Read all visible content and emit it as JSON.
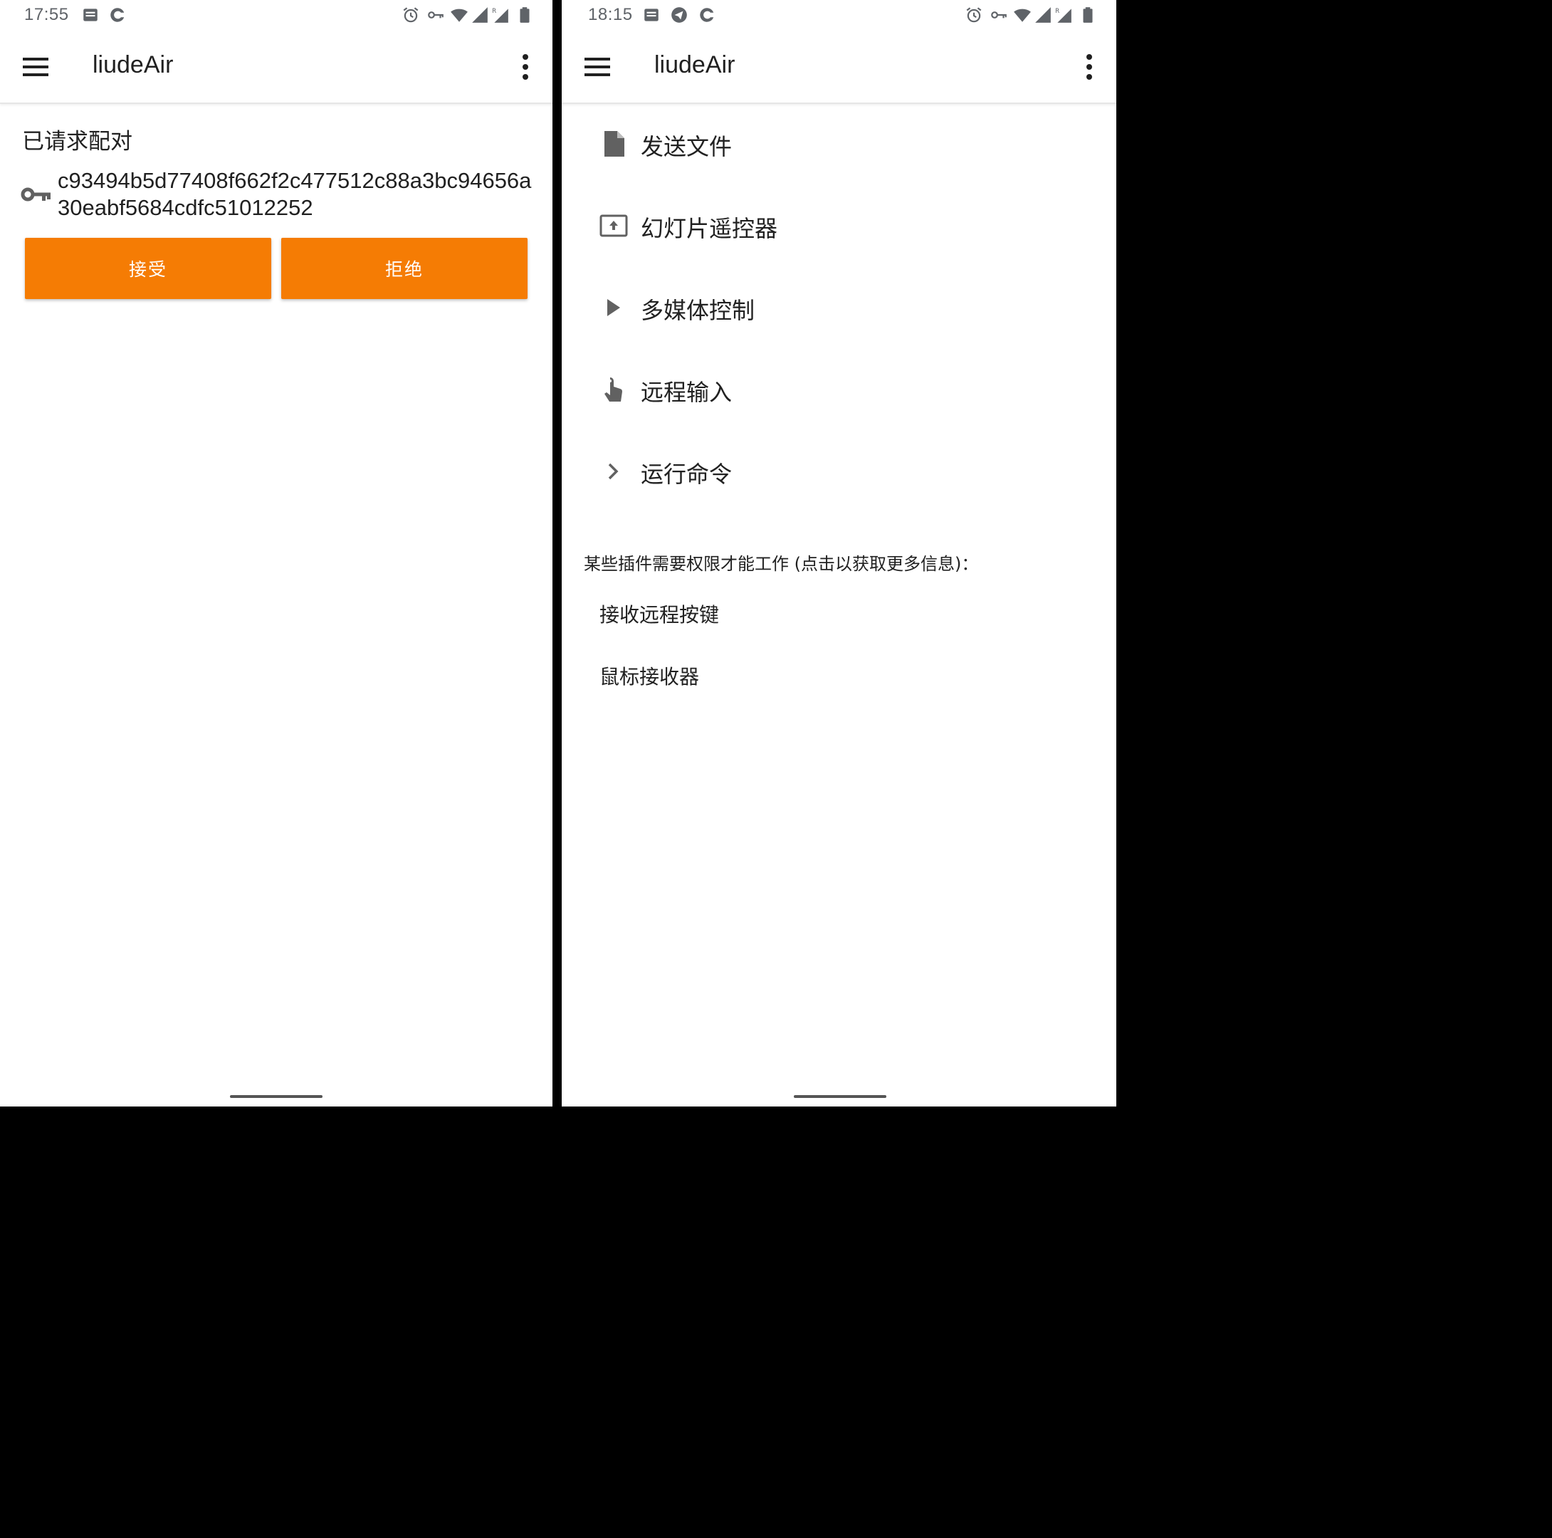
{
  "left": {
    "status": {
      "time": "17:55",
      "icons": [
        "notification-icon",
        "sync-icon",
        "alarm-icon",
        "vpn-key-icon",
        "wifi-icon",
        "signal-icon",
        "signal-roaming-icon",
        "battery-icon"
      ]
    },
    "toolbar": {
      "title": "liudeAir",
      "menu_icon": "hamburger-menu-icon",
      "overflow_icon": "more-vert-icon"
    },
    "pairing": {
      "heading": "已请求配对",
      "key_icon": "key-icon",
      "key": "c93494b5d77408f662f2c477512c88a3bc94656a30eabf5684cdfc51012252",
      "accept_label": "接受",
      "reject_label": "拒绝",
      "accent": "#f57c04"
    }
  },
  "right": {
    "status": {
      "time": "18:15",
      "icons": [
        "notification-icon",
        "telegram-icon",
        "sync-icon",
        "alarm-icon",
        "vpn-key-icon",
        "wifi-icon",
        "signal-icon",
        "signal-roaming-icon",
        "battery-icon"
      ]
    },
    "toolbar": {
      "title": "liudeAir",
      "menu_icon": "hamburger-menu-icon",
      "overflow_icon": "more-vert-icon"
    },
    "plugins": [
      {
        "label": "发送文件",
        "icon": "file-icon"
      },
      {
        "label": "幻灯片遥控器",
        "icon": "presentation-icon"
      },
      {
        "label": "多媒体控制",
        "icon": "play-icon"
      },
      {
        "label": "远程输入",
        "icon": "touch-icon"
      },
      {
        "label": "运行命令",
        "icon": "chevron-right-icon"
      }
    ],
    "permission_note": "某些插件需要权限才能工作 (点击以获取更多信息)：",
    "permission_items": [
      "接收远程按键",
      "鼠标接收器"
    ]
  }
}
